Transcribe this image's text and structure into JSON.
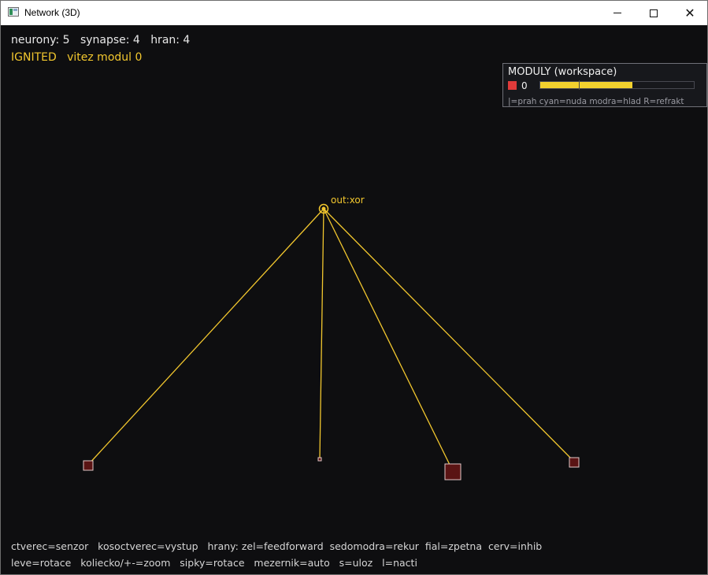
{
  "window": {
    "title": "Network (3D)",
    "app_icon": "app-window-icon",
    "controls": [
      "minimize-icon",
      "maximize-icon",
      "close-icon"
    ]
  },
  "hud": {
    "stats": "neurony: 5   synapse: 4   hran: 4",
    "status": "IGNITED   vitez modul 0"
  },
  "modules_panel": {
    "title": "MODULY (workspace)",
    "modules": [
      {
        "id": "0",
        "color": "#e03a3a",
        "activation": 0.6,
        "threshold": 0.25
      }
    ],
    "legend": "|=prah   cyan=nuda   modra=hlad   R=refrakt"
  },
  "network": {
    "output_node": {
      "label": "out:xor",
      "color": "#f2c72e"
    },
    "edge_color": "#f2c72e",
    "sensor_fill": "#5a1414"
  },
  "help": {
    "line1": "ctverec=senzor   kosoctverec=vystup   hrany: zel=feedforward  sedomodra=rekur  fial=zpetna  cerv=inhib",
    "line2": "leve=rotace   koliecko/+-=zoom   sipky=rotace   mezernik=auto   s=uloz   l=nacti"
  },
  "colors": {
    "background": "#0e0e10",
    "accent": "#f2c72e",
    "text": "#e8e8e8"
  }
}
